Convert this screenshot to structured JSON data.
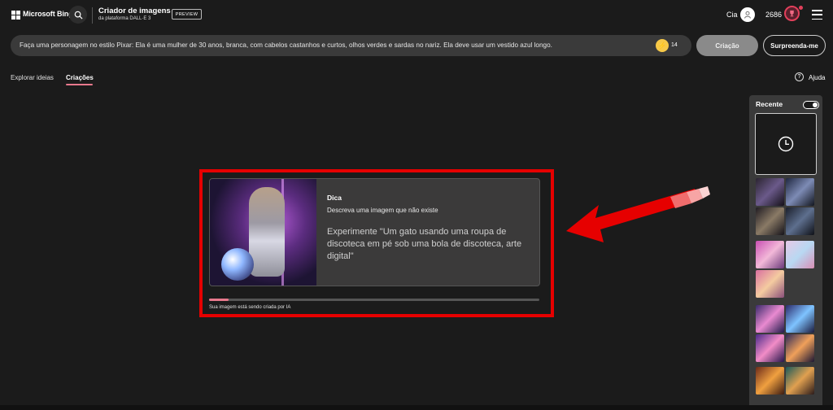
{
  "header": {
    "brand": "Microsoft Bing",
    "title": "Criador de imagens",
    "subtitle": "da plataforma DALL·E 3",
    "badge": "PREVIEW",
    "user_name": "Cia",
    "points": "2686",
    "icons": [
      "microsoft-logo-icon",
      "search-icon",
      "user-icon",
      "trophy-icon",
      "menu-icon"
    ]
  },
  "prompt": {
    "text": "Faça uma personagem no estilo Pixar: Ela é uma mulher de 30 anos, branca, com cabelos castanhos e curtos, olhos verdes e sardas no nariz. Ela deve usar um vestido azul longo.",
    "boosts": "14"
  },
  "buttons": {
    "create": "Criação",
    "surprise": "Surpreenda-me"
  },
  "tabs": {
    "explore": "Explorar ideias",
    "creations": "Criações"
  },
  "help": {
    "label": "Ajuda",
    "icon": "?"
  },
  "tip_card": {
    "title": "Dica",
    "description": "Descreva uma imagem que não existe",
    "example": "Experimente \"Um gato usando uma roupa de discoteca em pé sob uma bola de discoteca, arte digital\""
  },
  "progress": {
    "value": 0.06,
    "label": "Sua imagem está sendo criada por IA"
  },
  "sidebar": {
    "title": "Recente",
    "toggle_on": true
  },
  "colors": {
    "accent": "#e8798d",
    "highlight_box": "#e60000",
    "arrow": "#e60000",
    "background": "#1b1b1b"
  }
}
